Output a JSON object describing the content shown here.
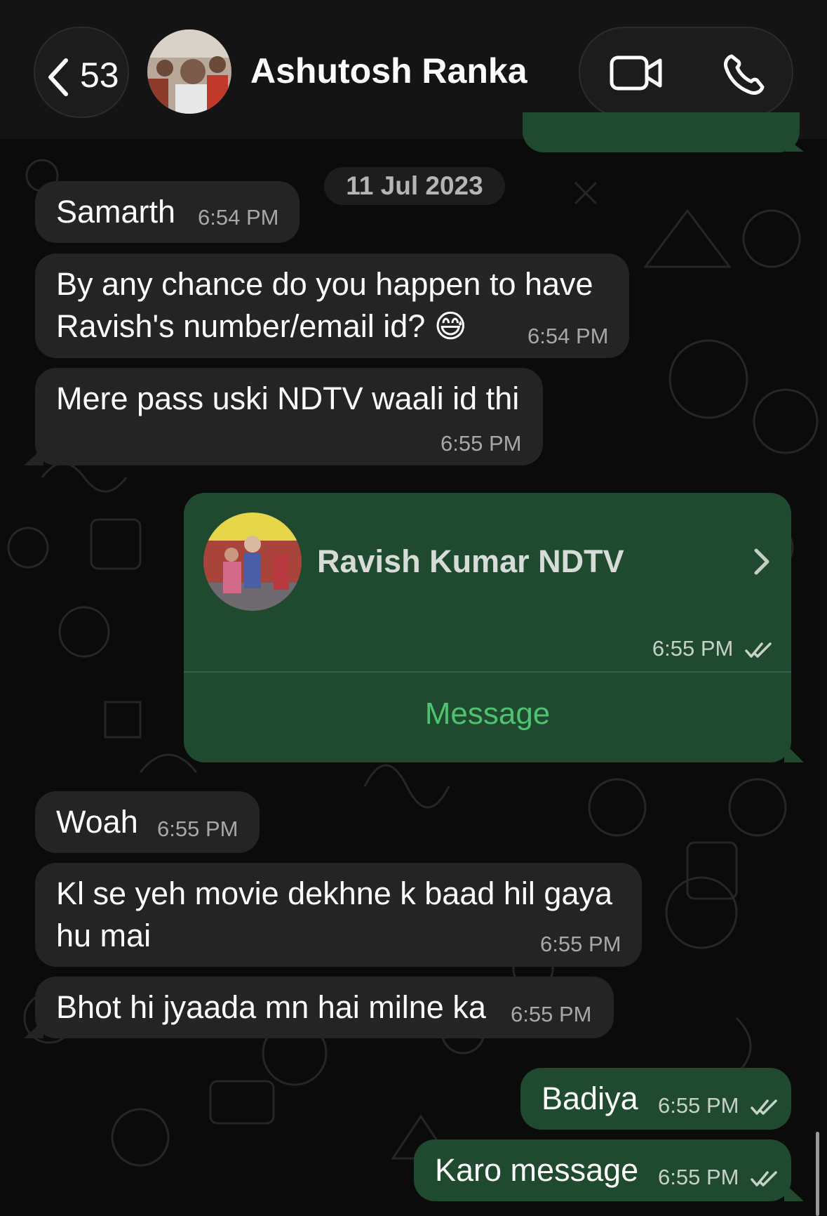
{
  "header": {
    "back_count": "53",
    "contact_name": "Ashutosh Ranka"
  },
  "date_chip": "11 Jul 2023",
  "messages": [
    {
      "direction": "in",
      "text_lines": [
        "Samarth"
      ],
      "time": "6:54 PM"
    },
    {
      "direction": "in",
      "text_lines": [
        "By any chance do you happen to have",
        "Ravish's number/email id? 😅"
      ],
      "time": "6:54 PM"
    },
    {
      "direction": "in",
      "text_lines": [
        "Mere pass uski NDTV waali id thi"
      ],
      "time": "6:55 PM"
    },
    {
      "direction": "in",
      "text_lines": [
        "Woah"
      ],
      "time": "6:55 PM"
    },
    {
      "direction": "in",
      "text_lines": [
        "Kl se yeh movie dekhne k baad hil gaya",
        "hu mai"
      ],
      "time": "6:55 PM"
    },
    {
      "direction": "in",
      "text_lines": [
        "Bhot hi jyaada mn hai milne ka"
      ],
      "time": "6:55 PM"
    },
    {
      "direction": "out",
      "text_lines": [
        "Badiya"
      ],
      "time": "6:55 PM",
      "status": "read"
    },
    {
      "direction": "out",
      "text_lines": [
        "Karo message"
      ],
      "time": "6:55 PM",
      "status": "read"
    }
  ],
  "contact_card": {
    "name": "Ravish Kumar NDTV",
    "time": "6:55 PM",
    "status": "read",
    "action_label": "Message"
  },
  "icons": {
    "back": "chevron-left-icon",
    "video": "video-camera-icon",
    "phone": "phone-icon",
    "ticks": "double-check-icon",
    "card_chevron": "chevron-right-icon"
  },
  "colors": {
    "background": "#0b0b0b",
    "incoming_bubble": "#242424",
    "outgoing_bubble": "#1f4a30",
    "accent_green": "#4fc26f"
  }
}
